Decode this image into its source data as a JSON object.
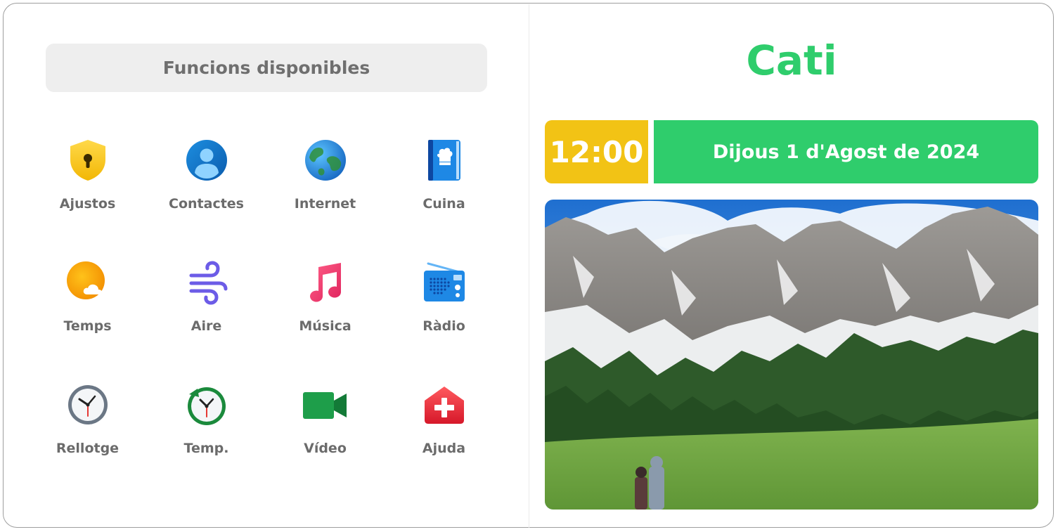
{
  "header": {
    "title": "Funcions disponibles"
  },
  "apps": [
    {
      "label": "Ajustos",
      "icon": "shield-lock-icon"
    },
    {
      "label": "Contactes",
      "icon": "contact-person-icon"
    },
    {
      "label": "Internet",
      "icon": "globe-icon"
    },
    {
      "label": "Cuina",
      "icon": "cookbook-icon"
    },
    {
      "label": "Temps",
      "icon": "weather-sun-cloud-icon"
    },
    {
      "label": "Aire",
      "icon": "wind-icon"
    },
    {
      "label": "Música",
      "icon": "music-note-icon"
    },
    {
      "label": "Ràdio",
      "icon": "radio-icon"
    },
    {
      "label": "Rellotge",
      "icon": "clock-icon"
    },
    {
      "label": "Temp.",
      "icon": "timer-icon"
    },
    {
      "label": "Vídeo",
      "icon": "video-camera-icon"
    },
    {
      "label": "Ajuda",
      "icon": "help-medical-cross-icon"
    }
  ],
  "user": {
    "name": "Cati"
  },
  "datetime": {
    "time": "12:00",
    "date": "Dijous 1 d'Agost de 2024"
  },
  "photo": {
    "subject": "mountain-landscape-photo"
  },
  "colors": {
    "accent_green": "#2fcd6c",
    "accent_yellow": "#f2c315",
    "label_grey": "#6b6b6b",
    "header_bg": "#eeeeee"
  }
}
